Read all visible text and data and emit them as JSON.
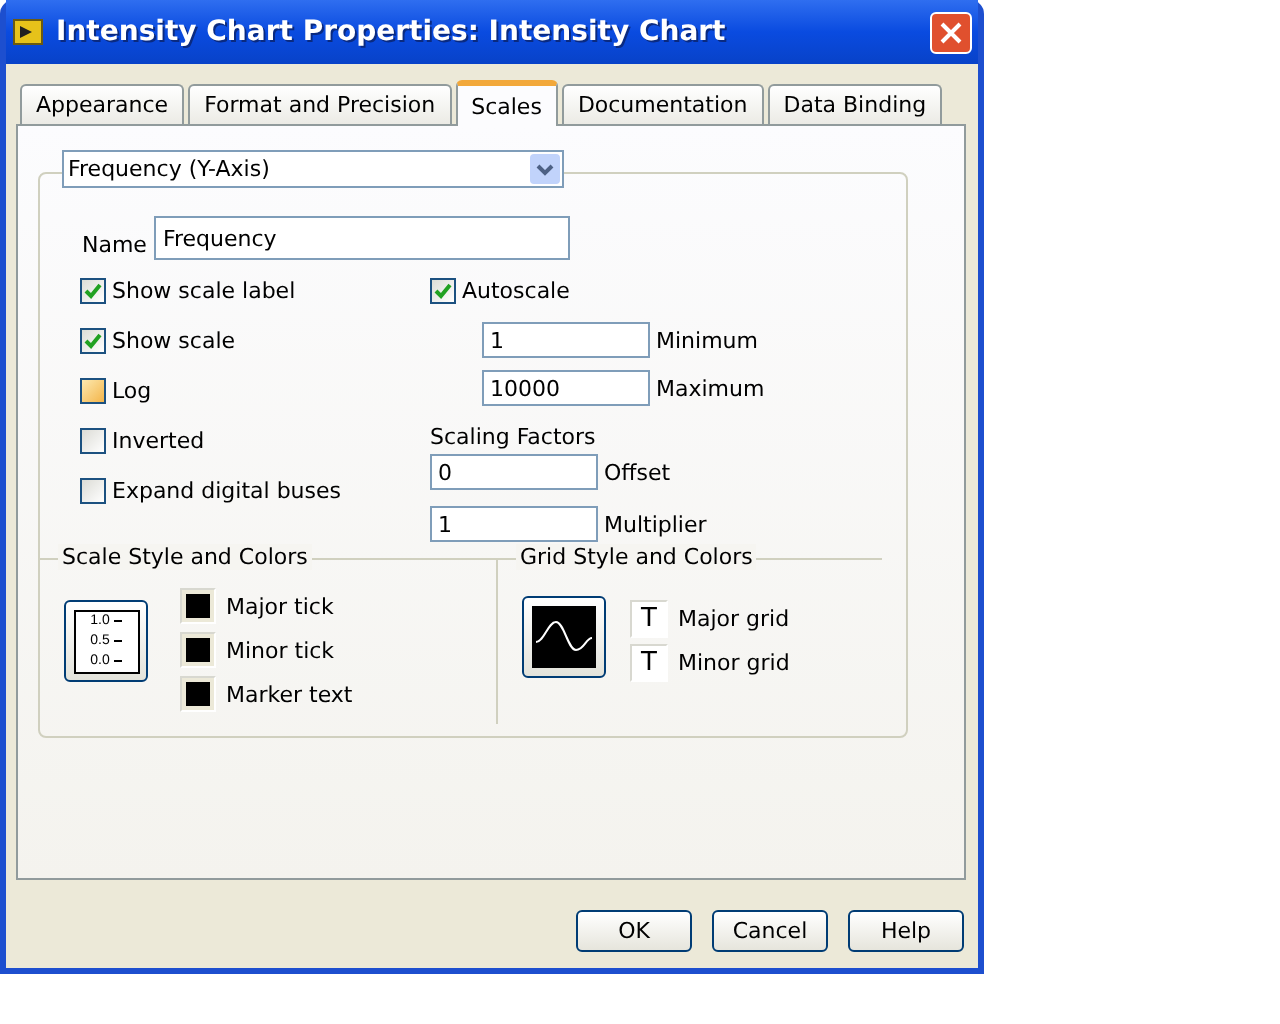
{
  "window": {
    "title": "Intensity Chart Properties: Intensity Chart"
  },
  "tabs": [
    {
      "label": "Appearance",
      "selected": false
    },
    {
      "label": "Format and Precision",
      "selected": false
    },
    {
      "label": "Scales",
      "selected": true
    },
    {
      "label": "Documentation",
      "selected": false
    },
    {
      "label": "Data Binding",
      "selected": false
    }
  ],
  "axis_select": {
    "value": "Frequency (Y-Axis)"
  },
  "name_field": {
    "label": "Name",
    "value": "Frequency"
  },
  "options": [
    {
      "label": "Show scale label",
      "checked": true,
      "highlighted": false
    },
    {
      "label": "Show scale",
      "checked": true,
      "highlighted": false
    },
    {
      "label": "Log",
      "checked": false,
      "highlighted": true
    },
    {
      "label": "Inverted",
      "checked": false,
      "highlighted": false
    },
    {
      "label": "Expand digital buses",
      "checked": false,
      "highlighted": false
    }
  ],
  "autoscale": {
    "label": "Autoscale",
    "checked": true
  },
  "range": [
    {
      "value": "1",
      "label": "Minimum"
    },
    {
      "value": "10000",
      "label": "Maximum"
    }
  ],
  "scaling_factors": {
    "title": "Scaling Factors",
    "fields": [
      {
        "value": "0",
        "label": "Offset"
      },
      {
        "value": "1",
        "label": "Multiplier"
      }
    ]
  },
  "scale_style": {
    "title": "Scale Style and Colors",
    "preview_labels": [
      "1.0",
      "0.5",
      "0.0"
    ],
    "colors": [
      {
        "label": "Major tick",
        "color": "#000000"
      },
      {
        "label": "Minor tick",
        "color": "#000000"
      },
      {
        "label": "Marker text",
        "color": "#000000"
      }
    ]
  },
  "grid_style": {
    "title": "Grid Style and Colors",
    "items": [
      {
        "label": "Major grid",
        "glyph": "T"
      },
      {
        "label": "Minor grid",
        "glyph": "T"
      }
    ]
  },
  "buttons": [
    "OK",
    "Cancel",
    "Help"
  ]
}
